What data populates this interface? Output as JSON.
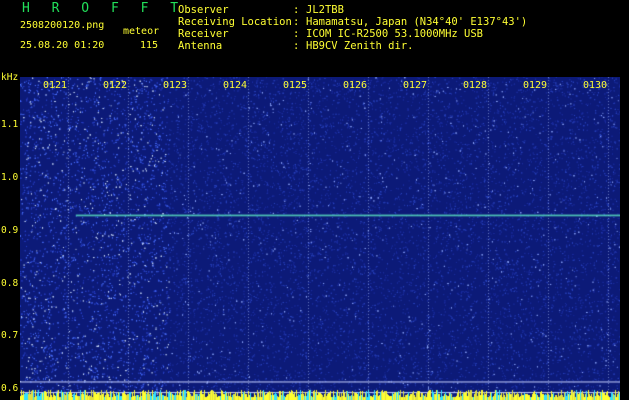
{
  "header": {
    "title": "H R O F F T",
    "filename": "2508200120.png",
    "datetime": "25.08.20 01:20",
    "category": "meteor",
    "count": "115"
  },
  "info": [
    {
      "label": "Observer",
      "value": "JL2TBB"
    },
    {
      "label": "Receiving Location",
      "value": "Hamamatsu, Japan (N34°40' E137°43')"
    },
    {
      "label": "Receiver",
      "value": "ICOM IC-R2500 53.1000MHz USB"
    },
    {
      "label": "Antenna",
      "value": "HB9CV Zenith dir."
    }
  ],
  "chart_data": {
    "type": "heatmap",
    "ylabel": "kHz",
    "yticks": [
      1.1,
      1.0,
      0.9,
      0.8,
      0.7,
      0.6
    ],
    "ylim": [
      0.58,
      1.19
    ],
    "x": [
      "0121",
      "0122",
      "0123",
      "0124",
      "0125",
      "0126",
      "0127",
      "0128",
      "0129",
      "0130"
    ],
    "xlim_minutes": [
      0,
      10
    ],
    "trace": {
      "start_minute": 0.93,
      "end_minute": 10.0,
      "freq_khz": 0.93
    },
    "reference_lines_khz": [
      0.615,
      0.595
    ],
    "noisier_region_minutes": [
      0,
      2.5
    ],
    "colors": {
      "background": "#0c1a78",
      "trace": "#66ffcc",
      "text": "#ffff33",
      "title": "#22e05a"
    }
  }
}
